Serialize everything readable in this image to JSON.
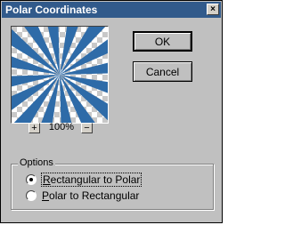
{
  "window": {
    "title": "Polar Coordinates",
    "close_glyph": "×"
  },
  "preview": {
    "zoom_in_label": "+",
    "zoom_level": "100%",
    "zoom_out_label": "−",
    "stripe_color": "#2e6ba8"
  },
  "buttons": {
    "ok_label": "OK",
    "cancel_label": "Cancel"
  },
  "options": {
    "group_label": "Options",
    "items": [
      {
        "mnemonic": "R",
        "rest": "ectangular to Polar",
        "checked": true
      },
      {
        "mnemonic": "P",
        "rest": "olar to Rectangular",
        "checked": false
      }
    ]
  },
  "colors": {
    "titlebar": "#315a8b",
    "face": "#c0c0c0"
  }
}
